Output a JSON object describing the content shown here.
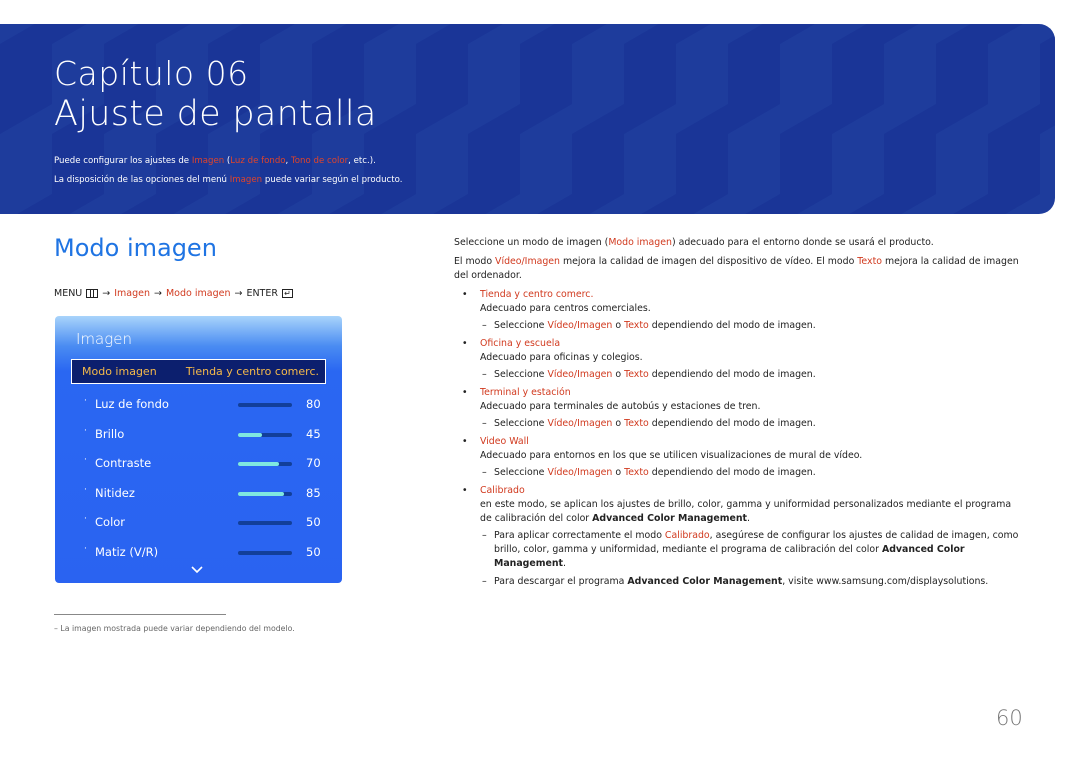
{
  "header": {
    "chapter": "Capítulo 06",
    "title": "Ajuste de pantalla",
    "desc1": {
      "pre": "Puede configurar los ajustes de ",
      "h1": "Imagen",
      "mid1": " (",
      "h2": "Luz de fondo",
      "mid2": ", ",
      "h3": "Tono de color",
      "post": ", etc.)."
    },
    "desc2": {
      "pre": "La disposición de las opciones del menú ",
      "h1": "Imagen",
      "post": " puede variar según el producto."
    },
    "bg_color": "#1e3c9c"
  },
  "section": {
    "title": "Modo imagen",
    "menu_path": {
      "menu": "MENU",
      "arrow": "→",
      "step1": "Imagen",
      "step2": "Modo imagen",
      "enter": "ENTER"
    }
  },
  "tv_menu": {
    "title": "Imagen",
    "selected": {
      "label": "Modo imagen",
      "value": "Tienda y centro comerc."
    },
    "items": [
      {
        "label": "Luz de fondo",
        "value": "80",
        "fill": 0
      },
      {
        "label": "Brillo",
        "value": "45",
        "fill": 0.45
      },
      {
        "label": "Contraste",
        "value": "70",
        "fill": 0.75
      },
      {
        "label": "Nitidez",
        "value": "85",
        "fill": 0.85
      },
      {
        "label": "Color",
        "value": "50",
        "fill": 0
      },
      {
        "label": "Matiz (V/R)",
        "value": "50",
        "fill": 0
      }
    ],
    "more_icon": "chevron-down-icon"
  },
  "footnote": "–  La imagen mostrada puede variar dependiendo del modelo.",
  "content": {
    "p1": {
      "pre": "Seleccione un modo de imagen (",
      "h": "Modo imagen",
      "post": ") adecuado para el entorno donde se usará el producto."
    },
    "p2": {
      "pre": "El modo ",
      "h1": "Vídeo/Imagen",
      "mid": " mejora la calidad de imagen del dispositivo de vídeo. El modo ",
      "h2": "Texto",
      "post": " mejora la calidad de imagen del ordenador."
    },
    "note_common": {
      "pre": "Seleccione ",
      "h1": "Vídeo/Imagen",
      "mid": " o ",
      "h2": "Texto",
      "post": " dependiendo del modo de imagen."
    },
    "modes": [
      {
        "name": "Tienda y centro comerc.",
        "desc": "Adecuado para centros comerciales."
      },
      {
        "name": "Oficina y escuela",
        "desc": "Adecuado para oficinas y colegios."
      },
      {
        "name": "Terminal y estación",
        "desc": "Adecuado para terminales de autobús y estaciones de tren."
      },
      {
        "name": "Video Wall",
        "desc": "Adecuado para entornos en los que se utilicen visualizaciones de mural de vídeo."
      }
    ],
    "calibrado": {
      "name": "Calibrado",
      "desc_pre": "en este modo, se aplican los ajustes de brillo, color, gamma y uniformidad personalizados mediante el programa de calibración del color ",
      "desc_b": "Advanced Color Management",
      "desc_post": ".",
      "note1": {
        "pre": "Para aplicar correctamente el modo ",
        "h": "Calibrado",
        "mid": ", asegúrese de configurar los ajustes de calidad de imagen, como brillo, color, gamma y uniformidad, mediante el programa de calibración del color ",
        "b": "Advanced Color Management",
        "post": "."
      },
      "note2": {
        "pre": "Para descargar el programa ",
        "b": "Advanced Color Management",
        "post": ", visite www.samsung.com/displaysolutions."
      }
    }
  },
  "page_number": "60"
}
